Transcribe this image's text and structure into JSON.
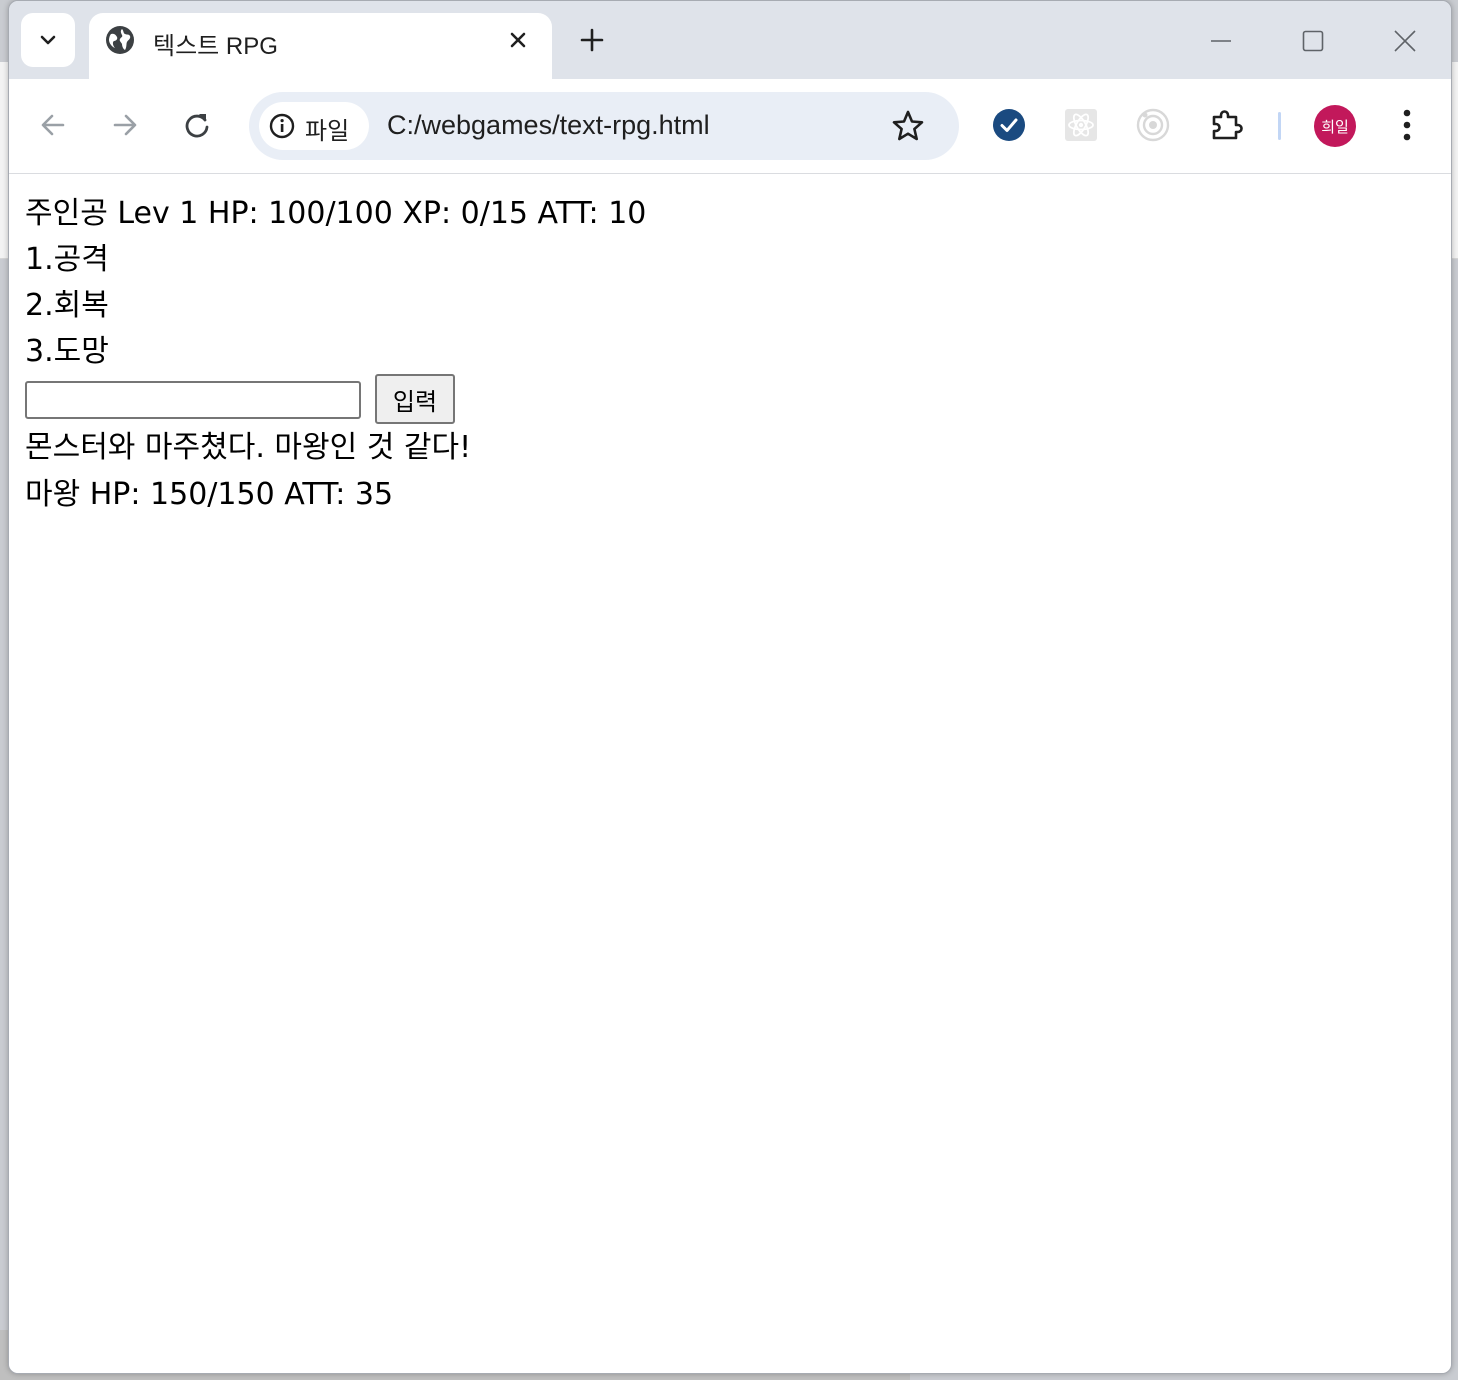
{
  "browser": {
    "tab": {
      "title": "텍스트 RPG",
      "favicon": "globe-icon"
    },
    "address_bar": {
      "site_chip_label": "파일",
      "url": "C:/webgames/text-rpg.html"
    },
    "profile": {
      "initials": "희일",
      "color": "#c2185b"
    },
    "icons": {
      "tab_search": "chevron-down-icon",
      "tab_close": "close-icon",
      "new_tab": "plus-icon",
      "minimize": "minimize-icon",
      "maximize": "maximize-icon",
      "close_window": "close-window-icon",
      "back": "back-arrow-icon",
      "forward": "forward-arrow-icon",
      "reload": "reload-icon",
      "site_info": "info-icon",
      "bookmark": "star-icon",
      "extension_1": "checkmark-circle-icon",
      "extension_2": "react-atom-icon",
      "extension_3": "target-icon",
      "extensions": "puzzle-icon",
      "menu": "three-dots-vertical-icon"
    },
    "accent_color": "#1a4a80"
  },
  "game": {
    "player_status": "주인공 Lev 1 HP: 100/100 XP: 0/15 ATT: 10",
    "menu": [
      "1.공격",
      "2.회복",
      "3.도망"
    ],
    "input": {
      "value": "",
      "button_label": "입력"
    },
    "message": "몬스터와 마주쳤다. 마왕인 것 같다!",
    "monster_status": "마왕 HP: 150/150 ATT: 35"
  }
}
